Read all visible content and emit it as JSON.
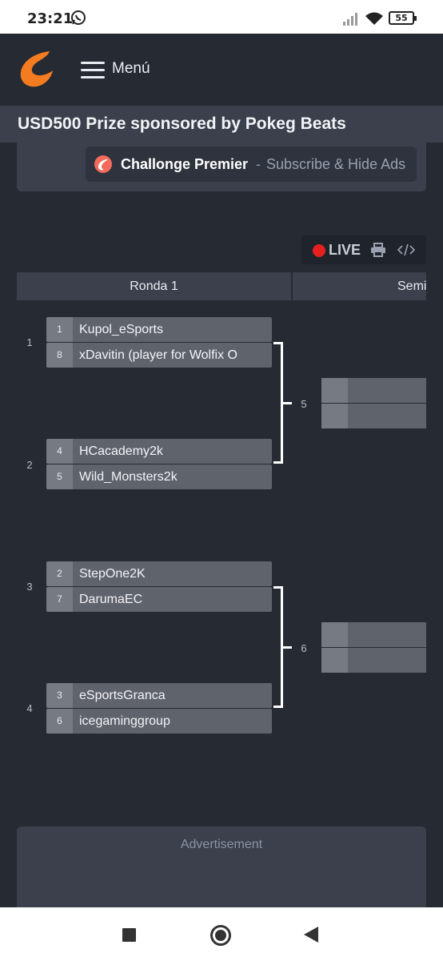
{
  "status_bar": {
    "time": "23:21",
    "battery": "55"
  },
  "header": {
    "menu_label": "Menú"
  },
  "tournament": {
    "title": "USD500 Prize sponsored by Pokeg Beats"
  },
  "premier": {
    "brand": "Challonge Premier",
    "separator": "-",
    "cta": "Subscribe & Hide Ads"
  },
  "toolbar": {
    "live_label": "LIVE"
  },
  "rounds": [
    "Ronda 1",
    "Semi"
  ],
  "matches": [
    {
      "number": "1",
      "players": [
        {
          "seed": "1",
          "name": "Kupol_eSports"
        },
        {
          "seed": "8",
          "name": "xDavitin (player for Wolfix O"
        }
      ]
    },
    {
      "number": "2",
      "players": [
        {
          "seed": "4",
          "name": "HCacademy2k"
        },
        {
          "seed": "5",
          "name": "Wild_Monsters2k"
        }
      ]
    },
    {
      "number": "3",
      "players": [
        {
          "seed": "2",
          "name": "StepOne2K"
        },
        {
          "seed": "7",
          "name": "DarumaEC"
        }
      ]
    },
    {
      "number": "4",
      "players": [
        {
          "seed": "3",
          "name": "eSportsGranca"
        },
        {
          "seed": "6",
          "name": "icegaminggroup"
        }
      ]
    }
  ],
  "round2_matches": [
    {
      "number": "5"
    },
    {
      "number": "6"
    }
  ],
  "ad": {
    "label": "Advertisement"
  },
  "colors": {
    "accent": "#f47c20",
    "live": "#e5201f",
    "background": "#262a33",
    "panel": "#3b404c"
  }
}
